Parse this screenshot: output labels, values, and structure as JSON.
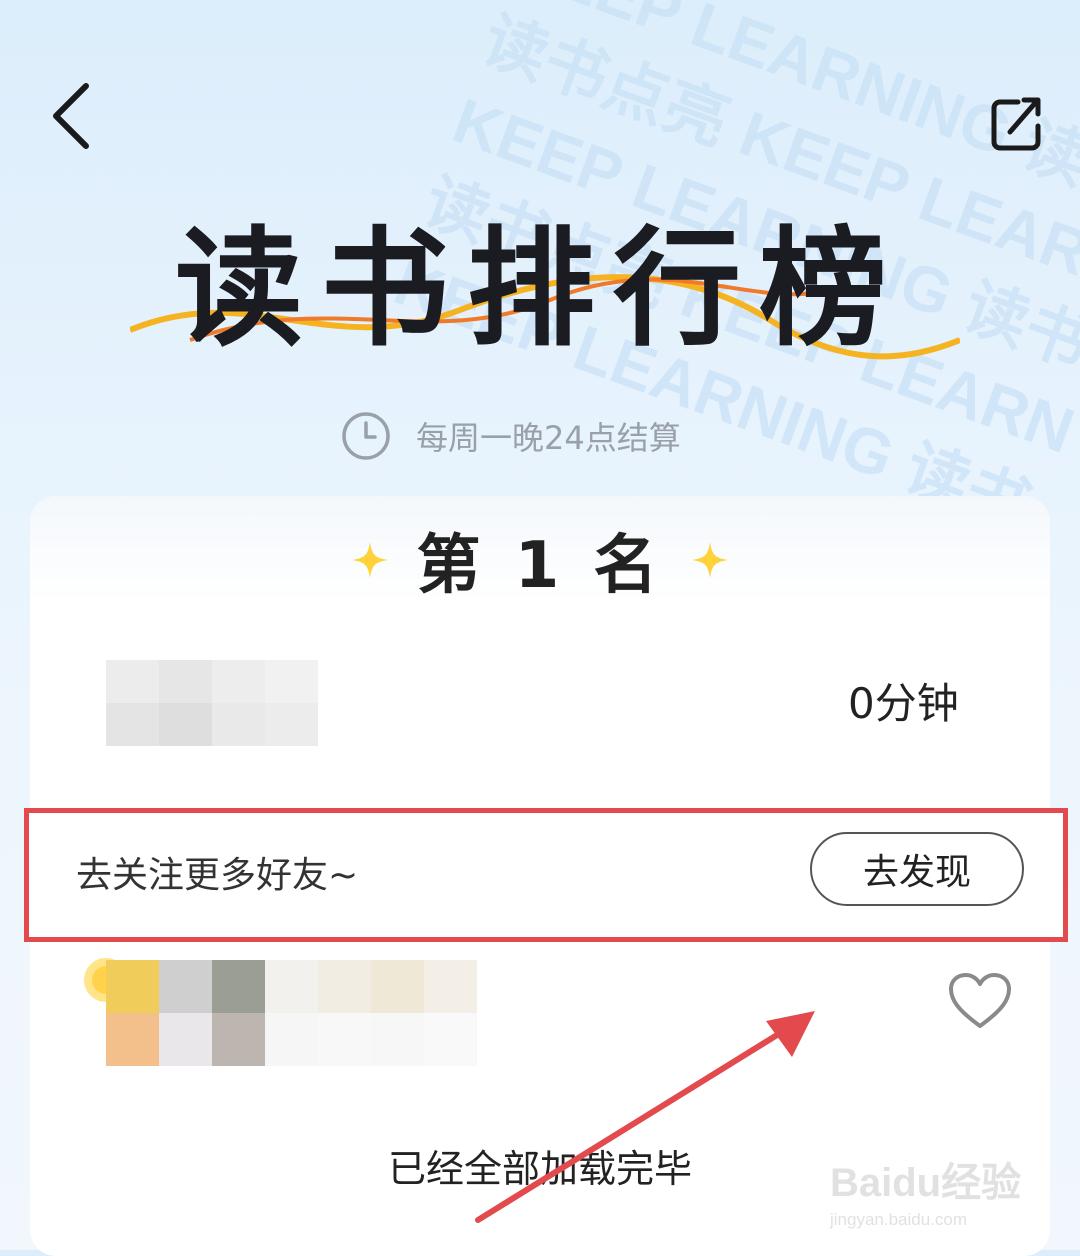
{
  "header": {
    "back_label": "back",
    "share_label": "share"
  },
  "title": "读书排行榜",
  "settle_text": "每周一晚24点结算",
  "rank_heading": "第 1 名",
  "top_entry": {
    "duration": "0分钟"
  },
  "follow_bar": {
    "text": "去关注更多好友~",
    "button_label": "去发现"
  },
  "footer_text": "已经全部加载完毕",
  "watermark": {
    "logo": "Baidu经验",
    "url": "jingyan.baidu.com"
  },
  "colors": {
    "accent_red": "#e24a4e",
    "star_yellow": "#ffd23a",
    "title_dark": "#1b1b22"
  }
}
